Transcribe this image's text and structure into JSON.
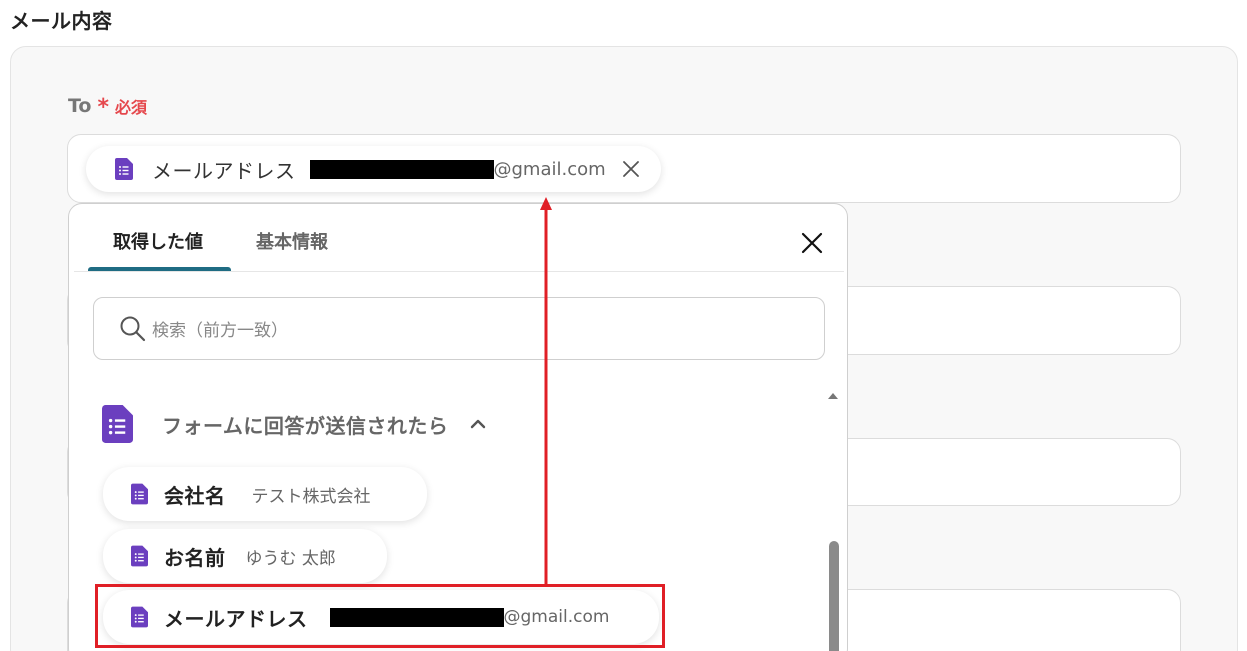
{
  "section_title": "メール内容",
  "to_field": {
    "label": "To",
    "required_star": "*",
    "required_text": "必須",
    "chip": {
      "name": "メールアドレス",
      "email_domain": "@gmail.com"
    }
  },
  "popup": {
    "tabs": [
      {
        "label": "取得した値",
        "active": true
      },
      {
        "label": "基本情報",
        "active": false
      }
    ],
    "search_placeholder": "検索（前方一致）",
    "group": {
      "title": "フォームに回答が送信されたら",
      "items": [
        {
          "label": "会社名",
          "value": "テスト株式会社"
        },
        {
          "label": "お名前",
          "value": "ゆうむ 太郎"
        },
        {
          "label": "メールアドレス",
          "value_domain": "@gmail.com"
        }
      ]
    }
  },
  "colors": {
    "required_red": "#e5484d",
    "tab_underline": "#1f6c83",
    "forms_icon_purple": "#6b3fbf",
    "annotation_red": "#e01f26"
  },
  "icons": {
    "forms": "google-forms-icon",
    "close": "close-icon",
    "search": "search-icon",
    "chevron": "chevron-up-icon"
  }
}
